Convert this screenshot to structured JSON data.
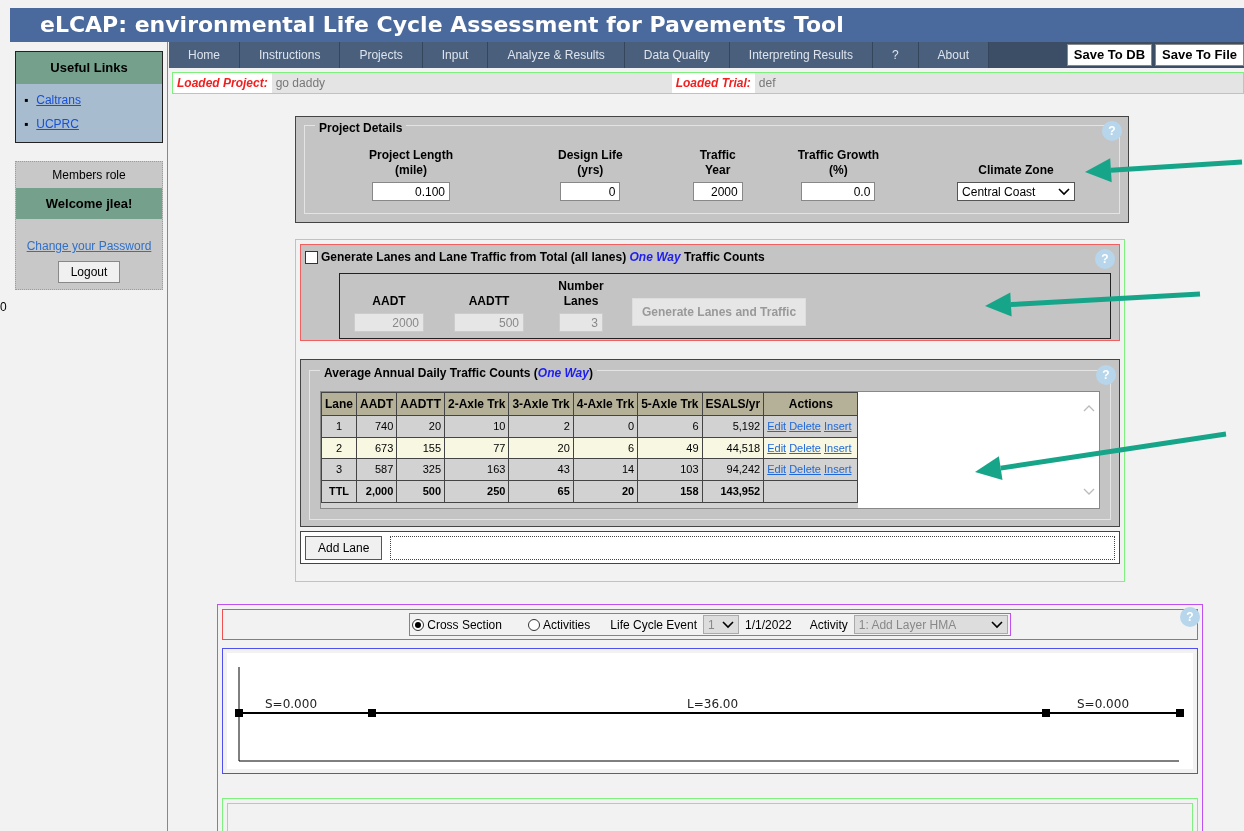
{
  "title": "eLCAP: environmental Life Cycle Assessment for Pavements Tool",
  "sidebar": {
    "links_title": "Useful Links",
    "bullet": "▪",
    "links": [
      "Caltrans",
      "UCPRC"
    ],
    "members_role": "Members role",
    "welcome": "Welcome jlea!",
    "change_password": "Change your Password",
    "logout": "Logout",
    "counter": "0"
  },
  "nav": {
    "items": [
      "Home",
      "Instructions",
      "Projects",
      "Input",
      "Analyze & Results",
      "Data Quality",
      "Interpreting Results",
      "?",
      "About"
    ],
    "buttons": [
      "Save To DB",
      "Save To File"
    ]
  },
  "loaded": {
    "project_label": "Loaded Project:",
    "project": "go daddy",
    "trial_label": "Loaded Trial:",
    "trial": "def"
  },
  "project_details": {
    "legend": "Project Details",
    "help": "?",
    "fields": [
      {
        "kind": "text",
        "label": "Project Length",
        "unit": "(mile)",
        "value": "0.100"
      },
      {
        "kind": "text",
        "label": "Design Life",
        "unit": "(yrs)",
        "value": "0"
      },
      {
        "kind": "text",
        "label": "Traffic",
        "unit": "Year",
        "value": "2000"
      },
      {
        "kind": "text",
        "label": "Traffic Growth",
        "unit": "(%)",
        "value": "0.0"
      },
      {
        "kind": "select",
        "label": "Climate Zone",
        "value": "Central Coast"
      }
    ]
  },
  "generate": {
    "checked": false,
    "title_before": "Generate Lanes and Lane Traffic from Total (all lanes)",
    "title_emphasis": "One Way",
    "title_after": "Traffic Counts",
    "help": "?",
    "fields": [
      {
        "label": "AADT",
        "value": "2000",
        "disabled": true
      },
      {
        "label": "AADTT",
        "value": "500",
        "disabled": true
      },
      {
        "label": "Number Lanes",
        "value": "3",
        "disabled": true
      }
    ],
    "button": {
      "label": "Generate Lanes and Traffic",
      "disabled": true
    }
  },
  "traffic": {
    "legend_before": "Average Annual Daily Traffic Counts (",
    "legend_emphasis": "One Way",
    "legend_after": ")",
    "help": "?",
    "columns": [
      "Lane",
      "AADT",
      "AADTT",
      "2-Axle Trk",
      "3-Axle Trk",
      "4-Axle Trk",
      "5-Axle Trk",
      "ESALS/yr",
      "Actions"
    ],
    "rows": [
      {
        "cells": [
          "1",
          "740",
          "20",
          "10",
          "2",
          "0",
          "6",
          "5,192"
        ],
        "actions": [
          "Edit",
          "Delete",
          "Insert"
        ]
      },
      {
        "cells": [
          "2",
          "673",
          "155",
          "77",
          "20",
          "6",
          "49",
          "44,518"
        ],
        "actions": [
          "Edit",
          "Delete",
          "Insert"
        ]
      },
      {
        "cells": [
          "3",
          "587",
          "325",
          "163",
          "43",
          "14",
          "103",
          "94,242"
        ],
        "actions": [
          "Edit",
          "Delete",
          "Insert"
        ]
      }
    ],
    "total": [
      "TTL",
      "2,000",
      "500",
      "250",
      "65",
      "20",
      "158",
      "143,952"
    ]
  },
  "add_lane": "Add Lane",
  "cross_section": {
    "help": "?",
    "radios": [
      {
        "label": "Cross Section",
        "selected": true
      },
      {
        "label": "Activities",
        "selected": false
      }
    ],
    "event_label": "Life Cycle Event",
    "event_value": "1",
    "date": "1/1/2022",
    "activity_label": "Activity",
    "activity_value": "1: Add Layer HMA",
    "diagram_labels": [
      "S=0.000",
      "L=36.00",
      "S=0.000"
    ]
  }
}
